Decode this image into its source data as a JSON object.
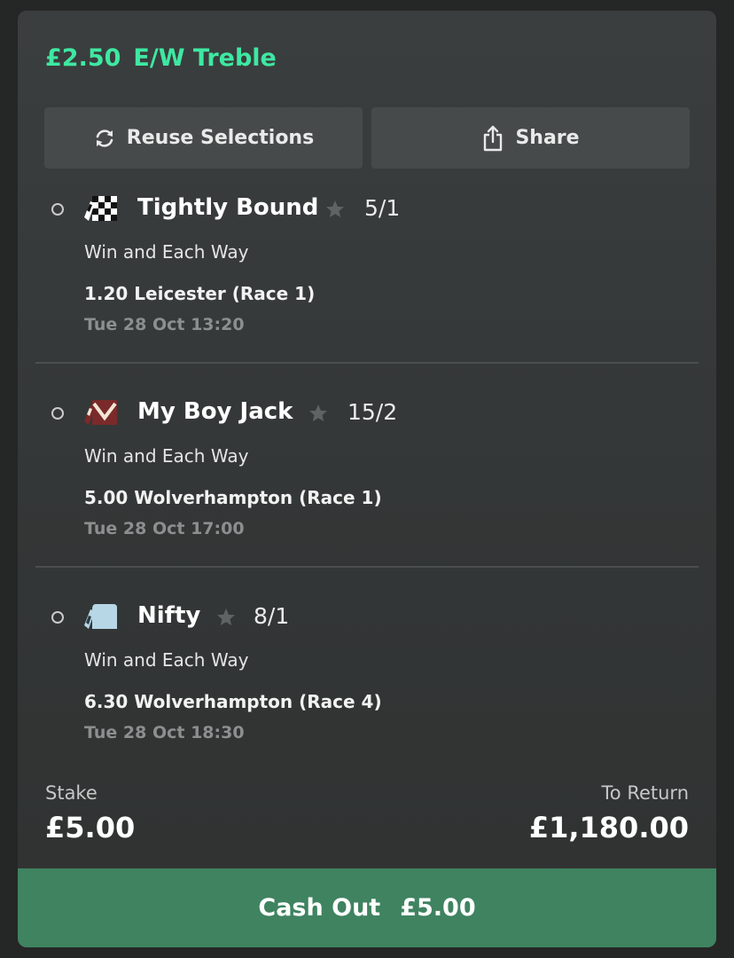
{
  "header": {
    "stake": "£2.50",
    "bet_type": "E/W Treble",
    "accent_color": "#3ee8a2"
  },
  "actions": {
    "reuse_label": "Reuse Selections",
    "reuse_icon": "refresh-icon",
    "share_label": "Share",
    "share_icon": "share-icon"
  },
  "legs": [
    {
      "horse": "Tightly Bound",
      "odds": "5/1",
      "market": "Win and Each Way",
      "race": "1.20 Leicester (Race 1)",
      "time": "Tue 28 Oct 13:20",
      "silk_icon": "checkered-silk-icon"
    },
    {
      "horse": "My Boy Jack",
      "odds": "15/2",
      "market": "Win and Each Way",
      "race": "5.00 Wolverhampton (Race 1)",
      "time": "Tue 28 Oct 17:00",
      "silk_icon": "maroon-chevron-silk-icon"
    },
    {
      "horse": "Nifty",
      "odds": "8/1",
      "market": "Win and Each Way",
      "race": "6.30 Wolverhampton (Race 4)",
      "time": "Tue 28 Oct 18:30",
      "silk_icon": "light-blue-silk-icon"
    }
  ],
  "summary": {
    "stake_label": "Stake",
    "stake_value": "£5.00",
    "return_label": "To Return",
    "return_value": "£1,180.00"
  },
  "cashout": {
    "label": "Cash Out",
    "amount": "£5.00",
    "color": "#3f8360"
  }
}
